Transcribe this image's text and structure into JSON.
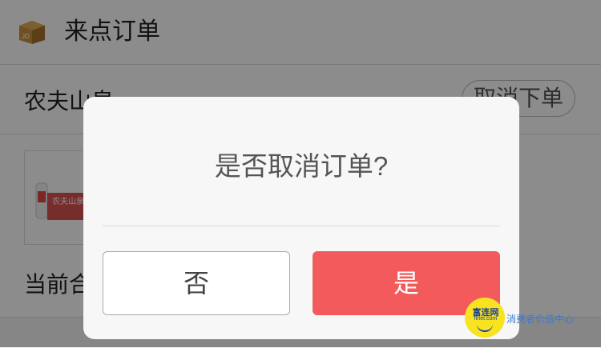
{
  "header": {
    "title": "来点订单",
    "icon": "jd-box-icon"
  },
  "shop": {
    "name": "农夫山泉",
    "cancel_button_label": "取消下单"
  },
  "product": {
    "label": "农夫山泉"
  },
  "summary": {
    "total_label": "当前合"
  },
  "dialog": {
    "question": "是否取消订单?",
    "no_label": "否",
    "yes_label": "是"
  },
  "watermark": {
    "brand": "富连网",
    "url": "flnet.com",
    "slogan": "消费者价值中心"
  },
  "colors": {
    "primary": "#f25a5c",
    "overlay": "rgba(0,0,0,0.45)",
    "watermark_yellow": "#f7e31f"
  }
}
